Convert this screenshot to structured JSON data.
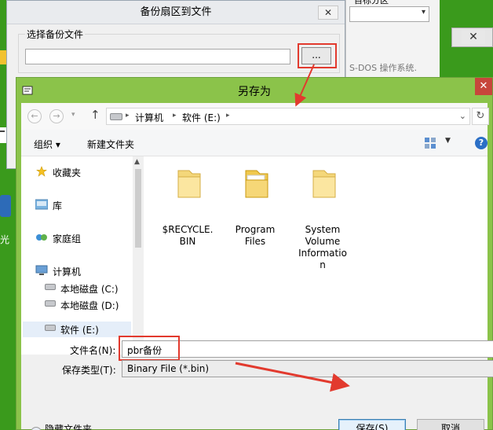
{
  "background_window": {
    "title": "备份扇区到文件",
    "group_label": "选择备份文件",
    "path_value": "",
    "browse_label": "...",
    "close_label": "✕"
  },
  "background_window2": {
    "top_text": "目标分区",
    "os_text": "S-DOS 操作系统.",
    "close_label": "✕"
  },
  "desktop": {
    "edge_label": "光"
  },
  "dialog": {
    "title": "另存为",
    "close_label": "✕",
    "nav": {
      "back": "←",
      "forward": "→",
      "recent": "▾",
      "up": "↑",
      "breadcrumbs": [
        "计算机",
        "软件 (E:)"
      ],
      "refresh": "↻"
    },
    "toolbar": {
      "organize": "组织 ▾",
      "new_folder": "新建文件夹",
      "help": "?"
    },
    "nav_pane": {
      "favorites": "收藏夹",
      "libraries": "库",
      "homegroup": "家庭组",
      "computer": "计算机",
      "drives": [
        "本地磁盘 (C:)",
        "本地磁盘 (D:)",
        "软件 (E:)"
      ],
      "selected": "软件 (E:)"
    },
    "files": [
      {
        "name": "$RECYCLE.BIN",
        "lines": [
          "$RECYCLE.",
          "BIN"
        ]
      },
      {
        "name": "Program Files",
        "lines": [
          "Program",
          "Files"
        ]
      },
      {
        "name": "System Volume Information",
        "lines": [
          "System",
          "Volume",
          "Informatio",
          "n"
        ]
      }
    ],
    "form": {
      "filename_label": "文件名(N):",
      "filename_value": "pbr备份",
      "filetype_label": "保存类型(T):",
      "filetype_value": "Binary File (*.bin)"
    },
    "hide_folders": "隐藏文件夹",
    "save_button": "保存(S)",
    "cancel_button": "取消"
  },
  "colors": {
    "desktop_green": "#3a9a1c",
    "dialog_frame": "#8bc34a",
    "close_red": "#c7463b",
    "annotation_red": "#e23a2e"
  }
}
